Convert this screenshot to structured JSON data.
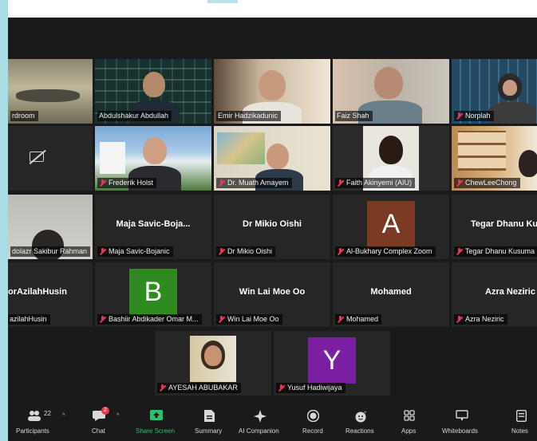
{
  "tiles": [
    {
      "name": "rdroom",
      "muted": false
    },
    {
      "name": "Abdulshakur Abdullah",
      "muted": false
    },
    {
      "name": "Emir Hadzikadunic",
      "muted": false
    },
    {
      "name": "Faiz Shah",
      "muted": false
    },
    {
      "name": "Norplah",
      "muted": true
    },
    {
      "name": "",
      "muted": false
    },
    {
      "name": "Frederik Holst",
      "muted": true
    },
    {
      "name": "Dr. Muath Amayem",
      "muted": true
    },
    {
      "name": "Faith Akinyemi (AIU)",
      "muted": true
    },
    {
      "name": "ChewLeeChong",
      "muted": true
    },
    {
      "name": "dolazr Sakibur Rahman",
      "muted": false
    },
    {
      "name": "Maja Savic-Bojanic",
      "display": "Maja  Savic-Boja...",
      "muted": true
    },
    {
      "name": "Dr Mikio Oishi",
      "display": "Dr Mikio Oishi",
      "muted": true
    },
    {
      "name": "Al-Bukhary Complex Zoom",
      "avatar": "A",
      "muted": true
    },
    {
      "name": "Tegar Dhanu Kusuma",
      "display": "Tegar  Dhanu  Ku",
      "muted": true
    },
    {
      "name": "azilahHusin",
      "display": "orAzilahHusin",
      "muted": false
    },
    {
      "name": "Bashiir Abdikader Omar M...",
      "avatar": "B",
      "muted": true
    },
    {
      "name": "Win Lai Moe Oo",
      "display": "Win Lai Moe Oo",
      "muted": true
    },
    {
      "name": "Mohamed",
      "display": "Mohamed",
      "muted": true
    },
    {
      "name": "Azra Neziric",
      "display": "Azra Neziric",
      "muted": true
    },
    {
      "name": "AYESAH ABUBAKAR",
      "muted": true
    },
    {
      "name": "Yusuf Hadiwijaya",
      "avatar": "Y",
      "muted": true
    }
  ],
  "colors": {
    "accent_green": "#27c26a",
    "active_speaker": "#d9e36a",
    "avatar_a": "#7a3b22",
    "avatar_b": "#2f8a1f",
    "avatar_y": "#7b1fa2",
    "muted_red": "#e8384f"
  },
  "toolbar": {
    "participants_label": "Participants",
    "participants_count": "22",
    "chat_label": "Chat",
    "chat_badge": "2",
    "share_label": "Share Screen",
    "summary_label": "Summary",
    "ai_label": "AI Companion",
    "record_label": "Record",
    "reactions_label": "Reactions",
    "apps_label": "Apps",
    "whiteboards_label": "Whiteboards",
    "notes_label": "Notes"
  },
  "icons": [
    "participants-icon",
    "chat-icon",
    "share-screen-icon",
    "summary-icon",
    "ai-companion-icon",
    "record-icon",
    "reactions-icon",
    "apps-icon",
    "whiteboards-icon",
    "notes-icon",
    "camera-off-icon",
    "muted-mic-icon"
  ]
}
